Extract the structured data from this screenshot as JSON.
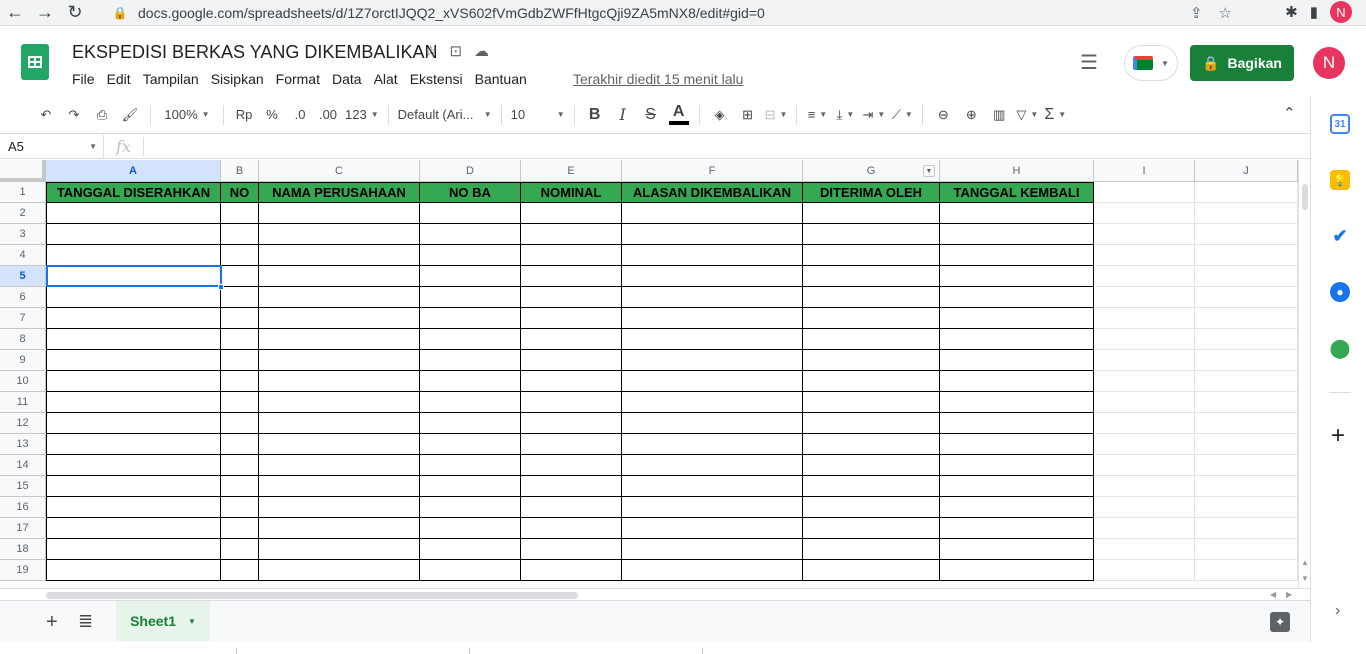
{
  "browser": {
    "url": "docs.google.com/spreadsheets/d/1Z7orctIJQQ2_xVS602fVmGdbZWFfHtgcQji9ZA5mNX8/edit#gid=0",
    "avatar": "N"
  },
  "header": {
    "title": "EKSPEDISI BERKAS YANG DIKEMBALIKAN",
    "menu": [
      "File",
      "Edit",
      "Tampilan",
      "Sisipkan",
      "Format",
      "Data",
      "Alat",
      "Ekstensi",
      "Bantuan"
    ],
    "last_edit": "Terakhir diedit 15 menit lalu",
    "share_label": "Bagikan",
    "avatar": "N"
  },
  "toolbar": {
    "zoom": "100%",
    "currency": "Rp",
    "percent": "%",
    "dec_decrease": ".0",
    "dec_increase": ".00",
    "more_formats": "123",
    "font": "Default (Ari...",
    "font_size": "10",
    "bold": "B",
    "italic": "I",
    "strike": "S",
    "text_color": "A",
    "sum": "Σ"
  },
  "formula_bar": {
    "name_box": "A5",
    "fx": "fx",
    "value": ""
  },
  "grid": {
    "columns": [
      "A",
      "B",
      "C",
      "D",
      "E",
      "F",
      "G",
      "H",
      "I",
      "J"
    ],
    "rows": [
      "1",
      "2",
      "3",
      "4",
      "5",
      "6",
      "7",
      "8",
      "9",
      "10",
      "11",
      "12",
      "13",
      "14",
      "15",
      "16",
      "17",
      "18",
      "19"
    ],
    "header_row": [
      "TANGGAL DISERAHKAN",
      "NO",
      "NAMA PERUSAHAAN",
      "NO BA",
      "NOMINAL",
      "ALASAN DIKEMBALIKAN",
      "DITERIMA OLEH",
      "TANGGAL KEMBALI"
    ],
    "header_fill": "#34a853",
    "selected_cell": "A5"
  },
  "sheets": {
    "tabs": [
      "Sheet1"
    ],
    "active": "Sheet1"
  },
  "side_panel": {
    "calendar_label": "31"
  }
}
